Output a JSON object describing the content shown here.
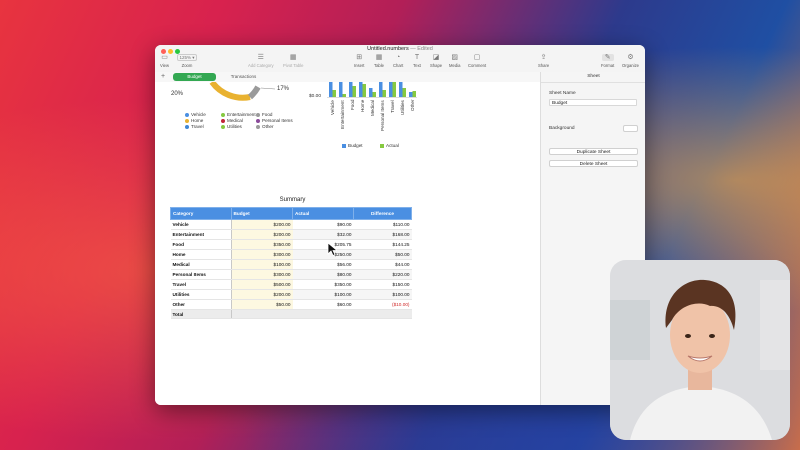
{
  "window": {
    "title": "Untitled.numbers",
    "title_status": "— Edited",
    "toolbar": {
      "view": "View",
      "zoom_value": "125%",
      "zoom_label": "Zoom",
      "add_category": "Add Category",
      "pivot_table": "Pivot Table",
      "insert": "Insert",
      "table": "Table",
      "chart": "Chart",
      "text": "Text",
      "shape": "Shape",
      "media": "Media",
      "comment": "Comment",
      "share": "Share",
      "format": "Format",
      "organize": "Organize"
    }
  },
  "sheet_tabs": [
    {
      "label": "Budget",
      "active": true
    },
    {
      "label": "Transactions",
      "active": false
    }
  ],
  "donut": {
    "pct_left": "20%",
    "pct_right": "17%",
    "legend": [
      {
        "label": "Vehicle",
        "color": "#4a8fe2"
      },
      {
        "label": "Entertainment",
        "color": "#86c940"
      },
      {
        "label": "Food",
        "color": "#9a9a9a"
      },
      {
        "label": "Home",
        "color": "#e9b230"
      },
      {
        "label": "Medical",
        "color": "#c2253a"
      },
      {
        "label": "Personal Items",
        "color": "#8a4a9a"
      },
      {
        "label": "Travel",
        "color": "#3f86d4"
      },
      {
        "label": "Utilities",
        "color": "#86c940"
      },
      {
        "label": "Other",
        "color": "#9a9a9a"
      }
    ]
  },
  "bar_chart": {
    "y_tick": "$0.00",
    "categories": [
      "Vehicle",
      "Entertainment",
      "Food",
      "Home",
      "Medical",
      "Personal Items",
      "Travel",
      "Utilities",
      "Other"
    ],
    "legend": [
      {
        "label": "Budget",
        "color": "#4a8fe2"
      },
      {
        "label": "Actual",
        "color": "#86c940"
      }
    ]
  },
  "summary": {
    "title": "Summary",
    "headers": [
      "Category",
      "Budget",
      "Actual",
      "Difference"
    ],
    "rows": [
      {
        "category": "Vehicle",
        "budget": "$200.00",
        "actual": "$90.00",
        "difference": "$110.00"
      },
      {
        "category": "Entertainment",
        "budget": "$200.00",
        "actual": "$32.00",
        "difference": "$168.00"
      },
      {
        "category": "Food",
        "budget": "$350.00",
        "actual": "$205.75",
        "difference": "$144.25"
      },
      {
        "category": "Home",
        "budget": "$300.00",
        "actual": "$250.00",
        "difference": "$50.00"
      },
      {
        "category": "Medical",
        "budget": "$100.00",
        "actual": "$56.00",
        "difference": "$44.00"
      },
      {
        "category": "Personal Items",
        "budget": "$300.00",
        "actual": "$80.00",
        "difference": "$220.00"
      },
      {
        "category": "Travel",
        "budget": "$500.00",
        "actual": "$350.00",
        "difference": "$150.00"
      },
      {
        "category": "Utilities",
        "budget": "$200.00",
        "actual": "$100.00",
        "difference": "$100.00"
      },
      {
        "category": "Other",
        "budget": "$50.00",
        "actual": "$60.00",
        "difference": "($10.00)"
      }
    ],
    "total_label": "Total"
  },
  "sidebar": {
    "header": "Sheet",
    "sheet_name_label": "Sheet Name",
    "sheet_name_value": "Budget",
    "background_label": "Background",
    "duplicate_button": "Duplicate Sheet",
    "delete_button": "Delete Sheet"
  }
}
